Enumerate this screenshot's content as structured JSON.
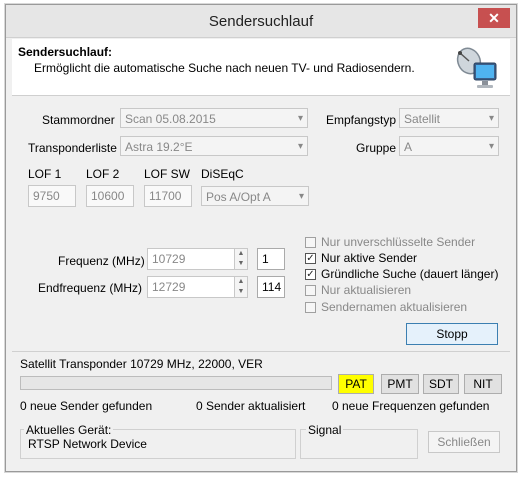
{
  "window": {
    "title": "Sendersuchlauf",
    "close_glyph": "✕"
  },
  "header": {
    "title": "Sendersuchlauf:",
    "description": "Ermöglicht die automatische Suche nach neuen TV- und Radiosendern.",
    "icon": "satellite-computer-icon"
  },
  "form": {
    "stammordner_label": "Stammordner",
    "stammordner_value": "Scan 05.08.2015",
    "empfangstyp_label": "Empfangstyp",
    "empfangstyp_value": "Satellit",
    "transponderliste_label": "Transponderliste",
    "transponderliste_value": "Astra 19.2°E",
    "gruppe_label": "Gruppe",
    "gruppe_value": "A",
    "lof1_label": "LOF 1",
    "lof1_value": "9750",
    "lof2_label": "LOF 2",
    "lof2_value": "10600",
    "lofsw_label": "LOF SW",
    "lofsw_value": "11700",
    "diseqc_label": "DiSEqC",
    "diseqc_value": "Pos A/Opt A",
    "frequenz_label": "Frequenz (MHz)",
    "frequenz_value": "10729",
    "frequenz_index": "1",
    "endfrequenz_label": "Endfrequenz (MHz)",
    "endfrequenz_value": "12729",
    "endfrequenz_index": "114"
  },
  "options": [
    {
      "label": "Nur unverschlüsselte Sender",
      "checked": false,
      "enabled": false
    },
    {
      "label": "Nur aktive Sender",
      "checked": true,
      "enabled": true
    },
    {
      "label": "Gründliche Suche (dauert länger)",
      "checked": true,
      "enabled": true
    },
    {
      "label": "Nur aktualisieren",
      "checked": false,
      "enabled": false
    },
    {
      "label": "Sendernamen aktualisieren",
      "checked": false,
      "enabled": false
    }
  ],
  "buttons": {
    "stopp": "Stopp",
    "schliessen": "Schließen"
  },
  "status": {
    "transponder": "Satellit Transponder 10729 MHz, 22000, VER",
    "tables": [
      {
        "label": "PAT",
        "active": true
      },
      {
        "label": "PMT",
        "active": false
      },
      {
        "label": "SDT",
        "active": false
      },
      {
        "label": "NIT",
        "active": false
      }
    ],
    "new_channels": "0 neue Sender gefunden",
    "updated_channels": "0 Sender aktualisiert",
    "new_frequencies": "0 neue Frequenzen gefunden"
  },
  "device": {
    "label": "Aktuelles Gerät:",
    "value": "RTSP Network Device",
    "signal_label": "Signal"
  },
  "colors": {
    "active_table": "#ffff00",
    "close_button": "#c75050",
    "stopp_border": "#3c7fb1"
  }
}
